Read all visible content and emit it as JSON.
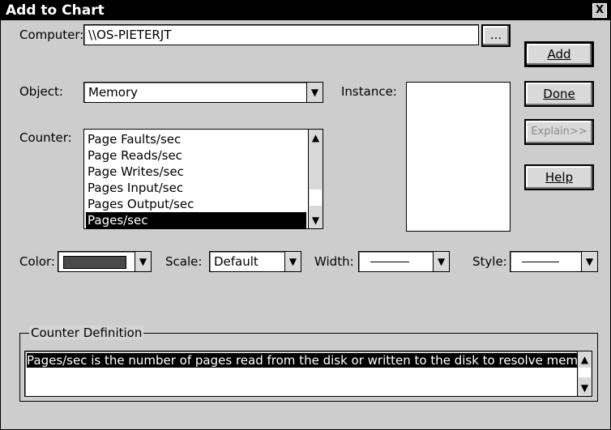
{
  "window": {
    "title": "Add to Chart",
    "close_glyph": "X"
  },
  "computer": {
    "label": "Computer:",
    "value": "\\\\OS-PIETERJT",
    "browse_label": "..."
  },
  "object": {
    "label": "Object:",
    "value": "Memory"
  },
  "instance": {
    "label": "Instance:"
  },
  "counter": {
    "label": "Counter:",
    "items": [
      "Page Faults/sec",
      "Page Reads/sec",
      "Page Writes/sec",
      "Pages Input/sec",
      "Pages Output/sec",
      "Pages/sec"
    ],
    "selected": "Pages/sec"
  },
  "buttons": {
    "add": "Add",
    "done": "Done",
    "explain": "Explain>>",
    "help": "Help"
  },
  "options": {
    "color_label": "Color:",
    "scale_label": "Scale:",
    "scale_value": "Default",
    "width_label": "Width:",
    "style_label": "Style:"
  },
  "definition": {
    "legend": "Counter Definition",
    "text": "Pages/sec is the number of pages read from the disk or written to the disk to resolve memory references to pages that were not in memory at the time of the reference.  This is the sum of Pages Input/sec and Pages Output/sec.  This counter includes paging traffic"
  },
  "colors": {
    "accent": "#000000",
    "swatch": "#4a4a4a"
  }
}
